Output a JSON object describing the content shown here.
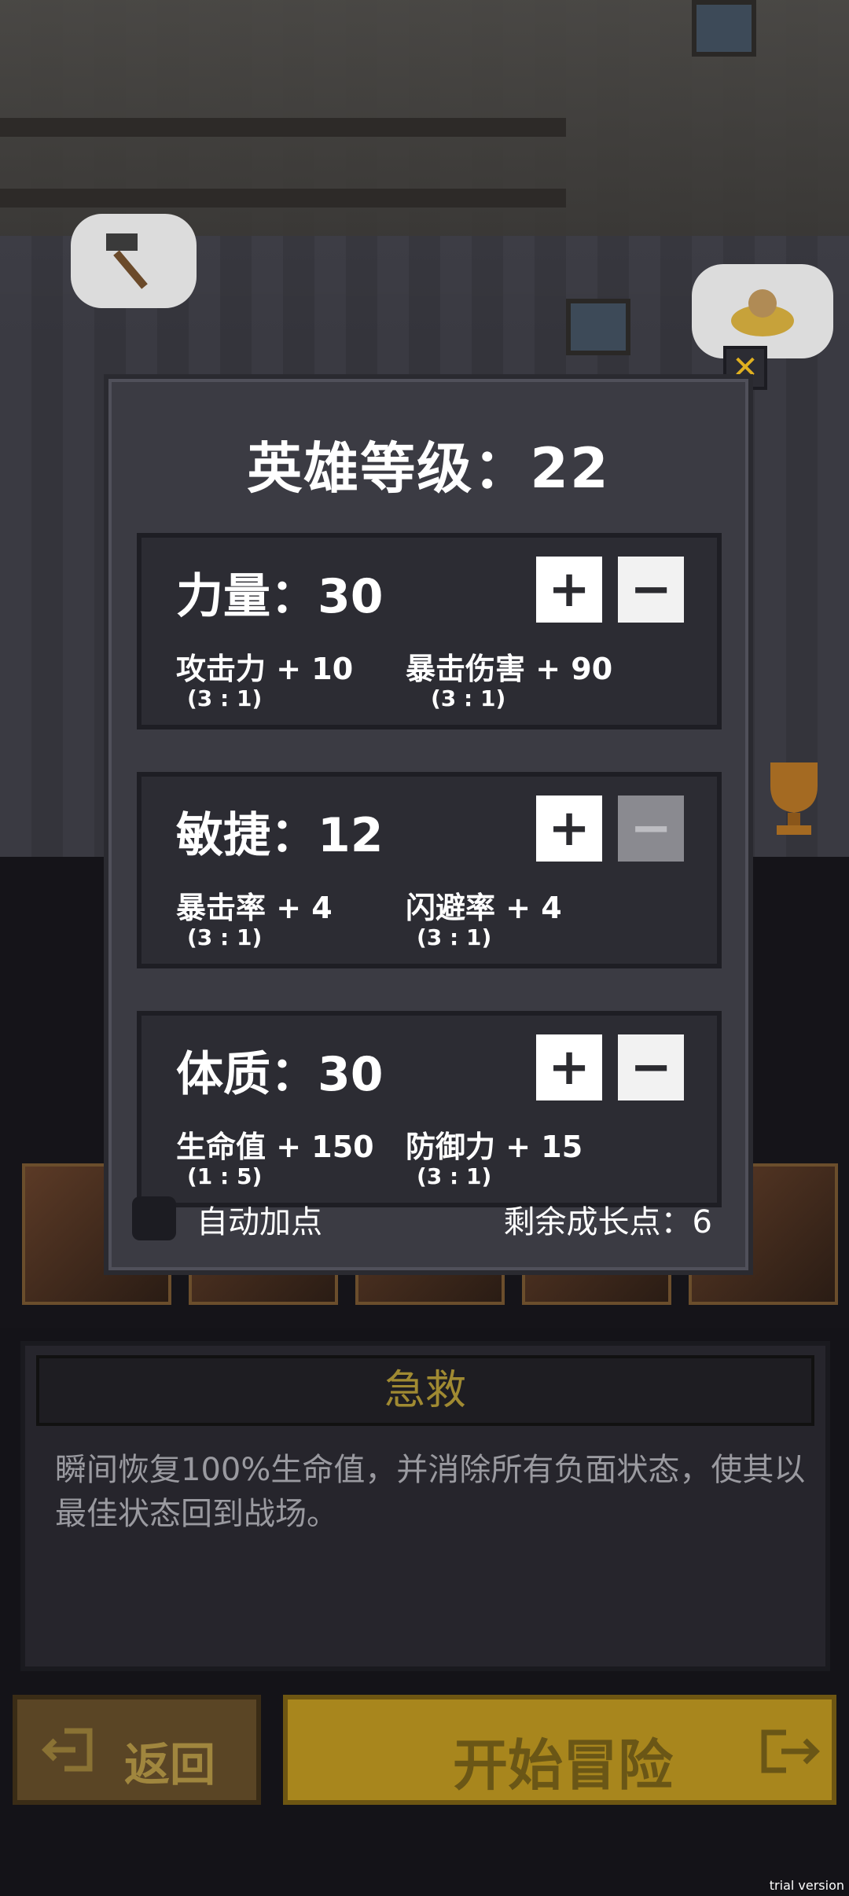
{
  "dialog": {
    "title": "英雄等级：22",
    "close_icon": "close-icon",
    "stats": [
      {
        "name": "力量：30",
        "plus": "+",
        "minus": "−",
        "minus_enabled": true,
        "left_sub": "攻击力 + 10",
        "left_ratio": "(3 : 1)",
        "right_sub": "暴击伤害 + 90",
        "right_ratio": "(3 : 1)"
      },
      {
        "name": "敏捷：12",
        "plus": "+",
        "minus": "−",
        "minus_enabled": false,
        "left_sub": "暴击率 + 4",
        "left_ratio": "(3 : 1)",
        "right_sub": "闪避率 + 4",
        "right_ratio": "(3 : 1)"
      },
      {
        "name": "体质：30",
        "plus": "+",
        "minus": "−",
        "minus_enabled": true,
        "left_sub": "生命值 + 150",
        "left_ratio": "(1 : 5)",
        "right_sub": "防御力 + 15",
        "right_ratio": "(3 : 1)"
      }
    ],
    "auto_label": "自动加点",
    "remaining": "剩余成长点：6"
  },
  "skill": {
    "title": "急救",
    "description": "瞬间恢复100%生命值，并消除所有负面状态，使其以最佳状态回到战场。"
  },
  "buttons": {
    "back": "返回",
    "start": "开始冒险"
  },
  "watermark": "trial version",
  "colors": {
    "gold": "#a8861d",
    "panel": "#3b3b43",
    "card": "#2c2c33"
  }
}
